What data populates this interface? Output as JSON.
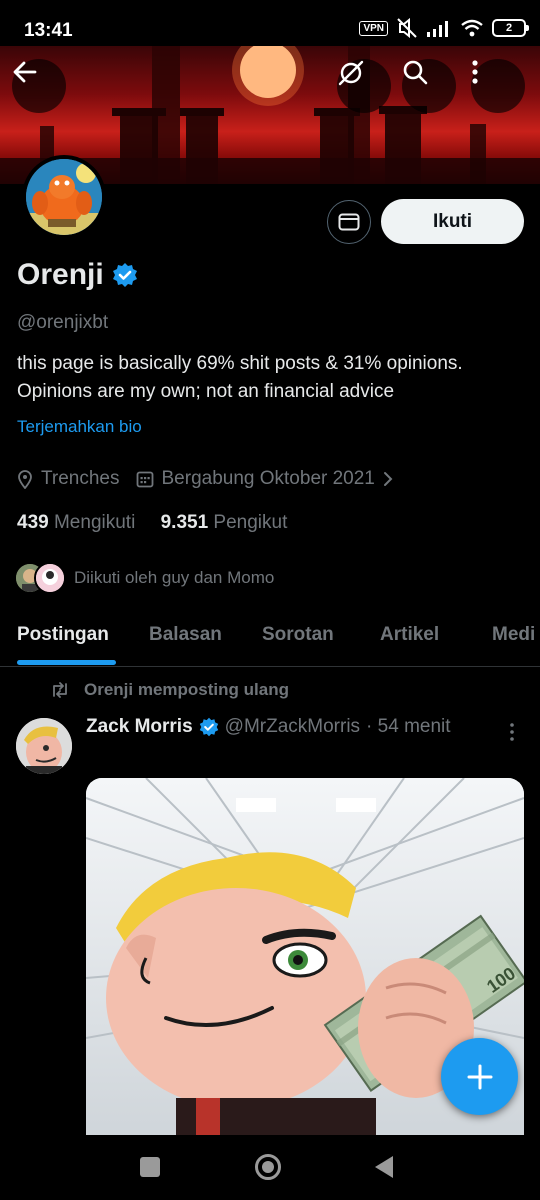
{
  "status_bar": {
    "time": "13:41",
    "vpn_label": "VPN",
    "battery": "2",
    "icons": [
      "vpn-icon",
      "mute-icon",
      "signal-icon",
      "wifi-icon",
      "battery-icon"
    ]
  },
  "header": {
    "back_icon": "arrow-left-icon",
    "grok_icon": "grok-icon",
    "search_icon": "search-icon",
    "more_icon": "more-vertical-icon"
  },
  "profile": {
    "name": "Orenji",
    "verified": true,
    "handle": "@orenjixbt",
    "bio": "this page is basically 69% shit posts & 31% opinions. Opinions are my own; not an financial advice",
    "translate_bio": "Terjemahkan bio",
    "location": "Trenches",
    "joined": "Bergabung Oktober 2021",
    "following_count": "439",
    "following_label": "Mengikuti",
    "followers_count": "9.351",
    "followers_label": "Pengikut",
    "followed_by": "Diikuti oleh guy dan Momo",
    "follow_button": "Ikuti"
  },
  "tabs": [
    {
      "label": "Postingan",
      "active": true
    },
    {
      "label": "Balasan",
      "active": false
    },
    {
      "label": "Sorotan",
      "active": false
    },
    {
      "label": "Artikel",
      "active": false
    },
    {
      "label": "Medi",
      "active": false
    }
  ],
  "post": {
    "repost_label": "Orenji memposting ulang",
    "author_name": "Zack Morris",
    "author_verified": true,
    "author_handle": "@MrZackMorris",
    "time": "· 54 menit"
  },
  "colors": {
    "accent": "#1d9bf0",
    "background": "#000000",
    "text": "#e7e9ea",
    "muted": "#71767b"
  }
}
